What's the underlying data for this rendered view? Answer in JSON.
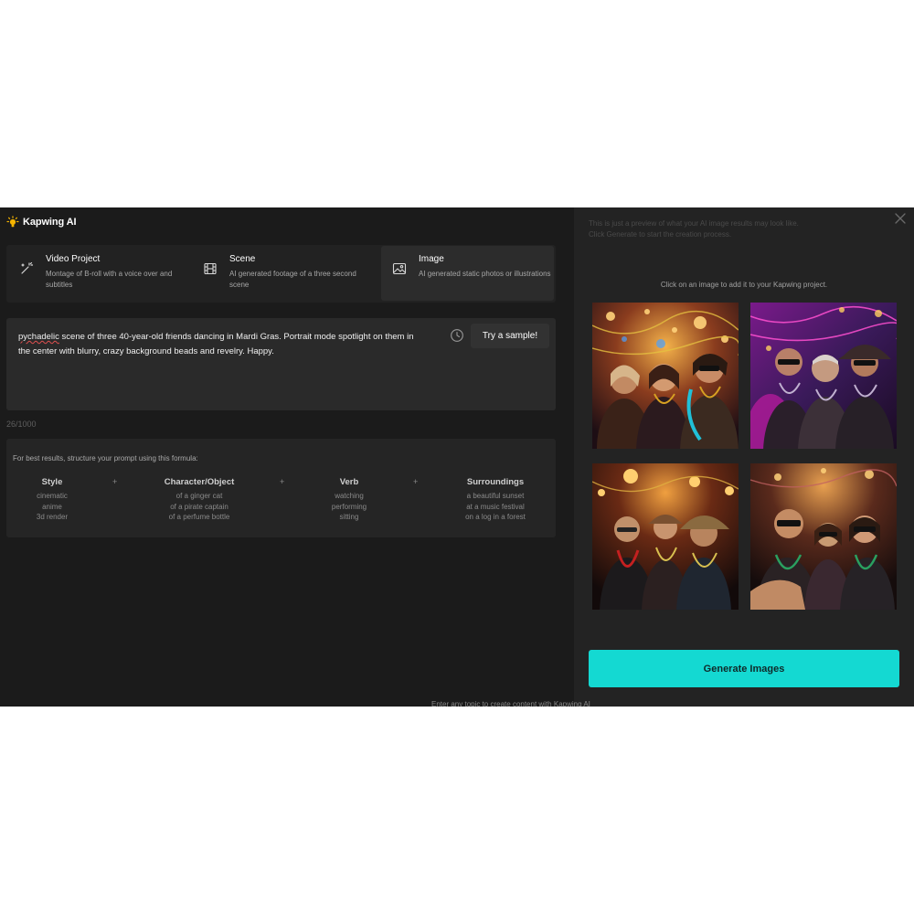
{
  "brand": {
    "name": "Kapwing AI"
  },
  "modes": [
    {
      "title": "Video Project",
      "desc": "Montage of B-roll with a voice over and subtitles",
      "icon": "magic-wand-icon",
      "active": false
    },
    {
      "title": "Scene",
      "desc": "AI generated footage of a three second scene",
      "icon": "film-icon",
      "active": false
    },
    {
      "title": "Image",
      "desc": "AI generated static photos or illustrations",
      "icon": "image-icon",
      "active": true
    }
  ],
  "prompt": {
    "misspelled_word": "pychadelic",
    "text_rest": " scene of three 40-year-old friends dancing in Mardi Gras. Portrait mode spotlight on them in the center with blurry, crazy background beads and revelry. Happy.",
    "try_sample_label": "Try a sample!",
    "counter": "26/1000"
  },
  "formula": {
    "intro": "For best results, structure your prompt using this formula:",
    "columns": [
      {
        "head": "Style",
        "items": [
          "cinematic",
          "anime",
          "3d render"
        ]
      },
      {
        "head": "Character/Object",
        "items": [
          "of a ginger cat",
          "of a pirate captain",
          "of a perfume bottle"
        ]
      },
      {
        "head": "Verb",
        "items": [
          "watching",
          "performing",
          "sitting"
        ]
      },
      {
        "head": "Surroundings",
        "items": [
          "a beautiful sunset",
          "at a music festival",
          "on a log in a forest"
        ]
      }
    ],
    "plus": "+"
  },
  "preview": {
    "note": "This is just a preview of what your AI image results may look like. Click Generate to start the creation process.",
    "hint": "Click on an image to add it to your Kapwing project.",
    "generate_label": "Generate Images"
  },
  "footer_ghost": "Enter any topic to create content with Kapwing AI",
  "colors": {
    "accent": "#14d9d2",
    "background": "#1b1b1b",
    "panel": "#232323"
  }
}
